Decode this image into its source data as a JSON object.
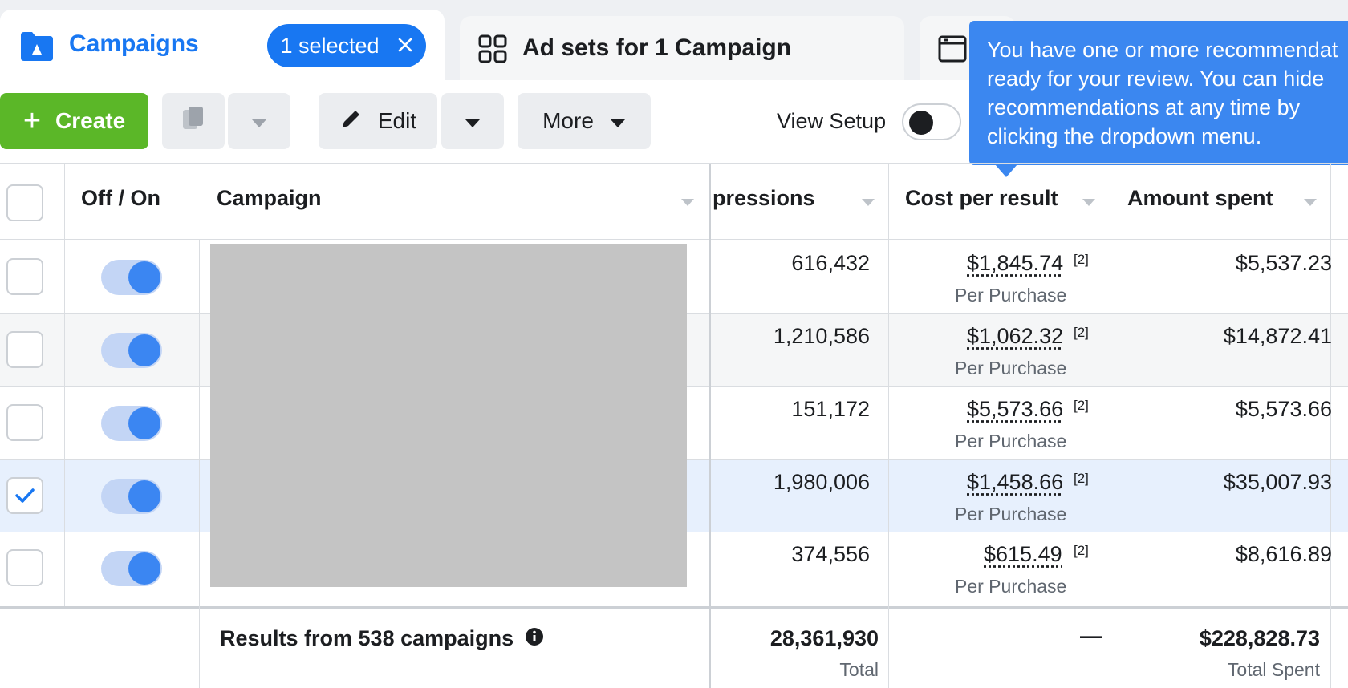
{
  "tabs": {
    "campaigns_label": "Campaigns",
    "selected_label": "1 selected",
    "adsets_label": "Ad sets for 1 Campaign"
  },
  "toolbar": {
    "create_label": "Create",
    "edit_label": "Edit",
    "more_label": "More",
    "view_setup_label": "View Setup"
  },
  "tooltip": {
    "line1": "You have one or more recommendat",
    "line2": "ready for your review. You can hide",
    "line3": "recommendations at any time by",
    "line4": "clicking the dropdown menu."
  },
  "table": {
    "headers": {
      "toggle": "Off / On",
      "campaign": "Campaign",
      "impressions": "pressions",
      "cost_per_result": "Cost per result",
      "amount_spent": "Amount spent"
    },
    "rows": [
      {
        "impressions": "616,432",
        "cost": "$1,845.74",
        "note": "[2]",
        "cost_sub": "Per Purchase",
        "spent": "$5,537.23",
        "checked": false
      },
      {
        "impressions": "1,210,586",
        "cost": "$1,062.32",
        "note": "[2]",
        "cost_sub": "Per Purchase",
        "spent": "$14,872.41",
        "checked": false
      },
      {
        "impressions": "151,172",
        "cost": "$5,573.66",
        "note": "[2]",
        "cost_sub": "Per Purchase",
        "spent": "$5,573.66",
        "checked": false
      },
      {
        "impressions": "1,980,006",
        "cost": "$1,458.66",
        "note": "[2]",
        "cost_sub": "Per Purchase",
        "spent": "$35,007.93",
        "checked": true
      },
      {
        "impressions": "374,556",
        "cost": "$615.49",
        "note": "[2]",
        "cost_sub": "Per Purchase",
        "spent": "$8,616.89",
        "checked": false
      }
    ],
    "footer": {
      "label": "Results from 538 campaigns",
      "impressions_total": "28,361,930",
      "impressions_sub": "Total",
      "cost": "—",
      "spent_total": "$228,828.73",
      "spent_sub": "Total Spent"
    }
  },
  "colors": {
    "accent_blue": "#1877f2",
    "create_green": "#5bb728",
    "tooltip_blue": "#3b87f0"
  }
}
